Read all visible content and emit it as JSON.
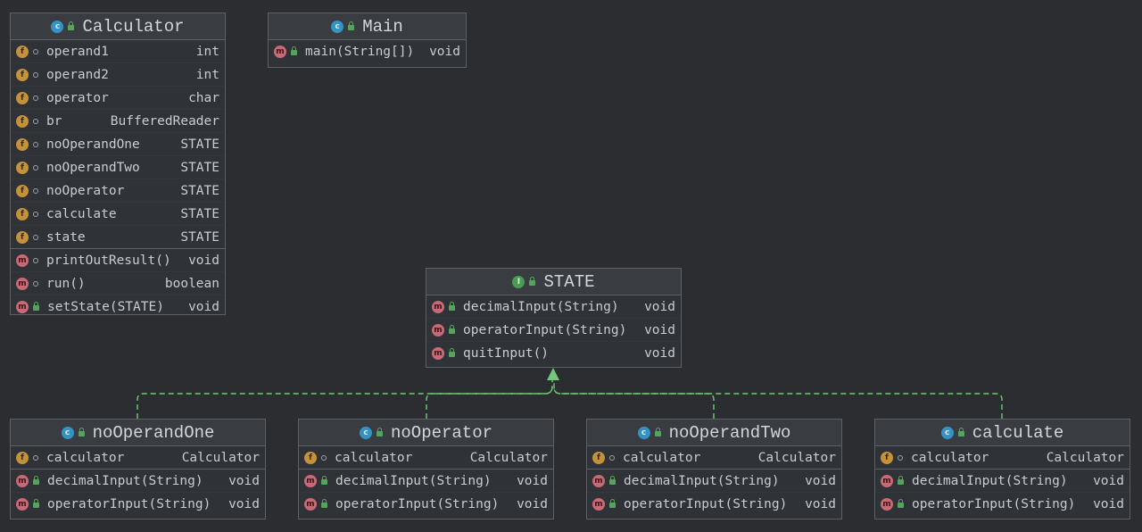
{
  "classes": {
    "calculator": {
      "name": "Calculator",
      "fields": [
        {
          "name": "operand1",
          "type": "int"
        },
        {
          "name": "operand2",
          "type": "int"
        },
        {
          "name": "operator",
          "type": "char"
        },
        {
          "name": "br",
          "type": "BufferedReader"
        },
        {
          "name": "noOperandOne",
          "type": "STATE"
        },
        {
          "name": "noOperandTwo",
          "type": "STATE"
        },
        {
          "name": "noOperator",
          "type": "STATE"
        },
        {
          "name": "calculate",
          "type": "STATE"
        },
        {
          "name": "state",
          "type": "STATE"
        }
      ],
      "methods": [
        {
          "name": "printOutResult()",
          "type": "void"
        },
        {
          "name": "run()",
          "type": "boolean"
        },
        {
          "name": "setState(STATE)",
          "type": "void"
        }
      ]
    },
    "main": {
      "name": "Main",
      "methods": [
        {
          "name": "main(String[])",
          "type": "void"
        }
      ]
    },
    "state": {
      "name": "STATE",
      "methods": [
        {
          "name": "decimalInput(String)",
          "type": "void"
        },
        {
          "name": "operatorInput(String)",
          "type": "void"
        },
        {
          "name": "quitInput()",
          "type": "void"
        }
      ]
    },
    "no_operand_one": {
      "name": "noOperandOne",
      "fields": [
        {
          "name": "calculator",
          "type": "Calculator"
        }
      ],
      "methods": [
        {
          "name": "decimalInput(String)",
          "type": "void"
        },
        {
          "name": "operatorInput(String)",
          "type": "void"
        }
      ]
    },
    "no_operator": {
      "name": "noOperator",
      "fields": [
        {
          "name": "calculator",
          "type": "Calculator"
        }
      ],
      "methods": [
        {
          "name": "decimalInput(String)",
          "type": "void"
        },
        {
          "name": "operatorInput(String)",
          "type": "void"
        }
      ]
    },
    "no_operand_two": {
      "name": "noOperandTwo",
      "fields": [
        {
          "name": "calculator",
          "type": "Calculator"
        }
      ],
      "methods": [
        {
          "name": "decimalInput(String)",
          "type": "void"
        },
        {
          "name": "operatorInput(String)",
          "type": "void"
        }
      ]
    },
    "calculate": {
      "name": "calculate",
      "fields": [
        {
          "name": "calculator",
          "type": "Calculator"
        }
      ],
      "methods": [
        {
          "name": "decimalInput(String)",
          "type": "void"
        },
        {
          "name": "operatorInput(String)",
          "type": "void"
        }
      ]
    }
  },
  "badges": {
    "class": "c",
    "interface": "I",
    "field": "f",
    "method": "m"
  },
  "colors": {
    "background": "#2b2d30",
    "realization_line": "#74c77a",
    "class_badge": "#3592c4",
    "interface_badge": "#499c54",
    "field_badge": "#c59239",
    "method_badge": "#c76a76"
  }
}
